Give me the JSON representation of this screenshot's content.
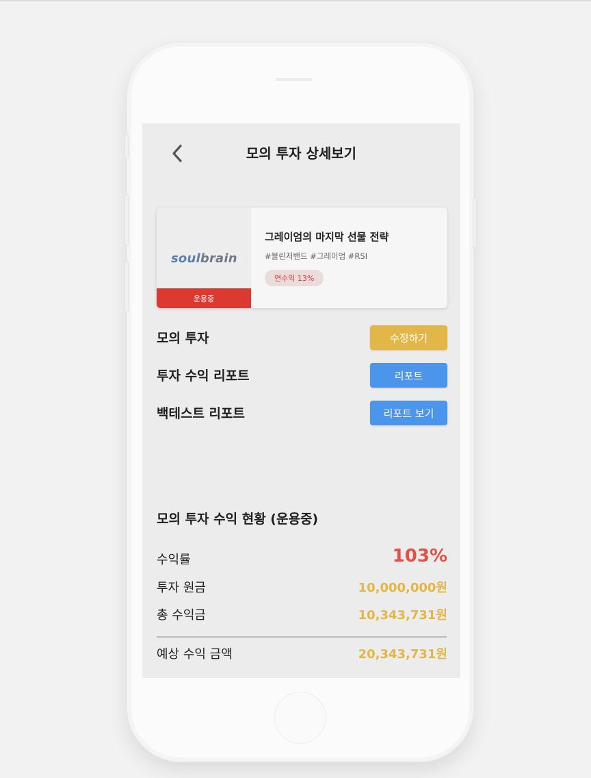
{
  "header": {
    "title": "모의 투자 상세보기",
    "back_icon": "chevron-left-icon"
  },
  "card": {
    "logo_prefix": "soul",
    "logo_rest": "brain",
    "status": "운용중",
    "title": "그레이엄의 마지막 선물 전략",
    "tags": "#블린저밴드 #그레이엄 #RSI",
    "badge": "연수익 13%"
  },
  "actions": [
    {
      "label": "모의 투자",
      "button": "수정하기",
      "color": "#e2b748"
    },
    {
      "label": "투자 수익 리포트",
      "button": "리포트",
      "color": "#4b95ea"
    },
    {
      "label": "백테스트 리포트",
      "button": "리포트 보기",
      "color": "#4b95ea"
    }
  ],
  "summary": {
    "title": "모의 투자 수익 현황 (운용중)",
    "rate_label": "수익률",
    "rate_value": "103%",
    "principal_label": "투자 원금",
    "principal_value": "10,000,000원",
    "profit_label": "총 수익금",
    "profit_value": "10,343,731원",
    "expected_label": "예상 수익 금액",
    "expected_value": "20,343,731원"
  },
  "colors": {
    "accent_red": "#dc3a30",
    "gold": "#e2b748",
    "blue": "#4b95ea",
    "rate_red": "#e35045"
  }
}
